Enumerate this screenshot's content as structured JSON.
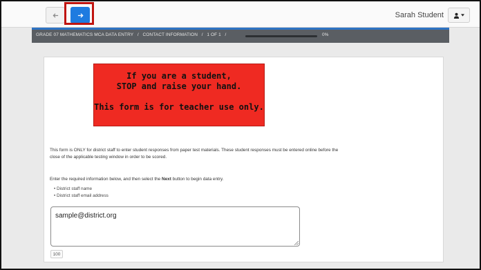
{
  "toolbar": {
    "back_icon": "arrow-left-icon",
    "forward_icon": "arrow-right-icon"
  },
  "user": {
    "name": "Sarah Student",
    "menu_icon": "user-icon"
  },
  "breadcrumb": {
    "items": [
      "GRADE 07 MATHEMATICS MCA DATA ENTRY",
      "CONTACT INFORMATION",
      "1 OF 1"
    ],
    "separator": "/",
    "progress_percent": 0,
    "progress_label": "0%"
  },
  "warning": {
    "line1": "If you are a student,",
    "line2": "STOP and raise your hand.",
    "line3": "This form is for teacher use only."
  },
  "content": {
    "paragraph": "This form is ONLY for district staff to enter student responses from paper test materials. These student responses must be entered online before the close of the applicable testing window in order to be scored.",
    "instruction_before": "Enter the required information below, and then select the ",
    "instruction_bold": "Next",
    "instruction_after": " button to begin data entry.",
    "bullets": [
      "District staff name",
      "District staff email address"
    ]
  },
  "input": {
    "value": "sample@district.org",
    "char_count": "100"
  },
  "colors": {
    "accent_blue": "#1e7be0",
    "highlight_red": "#c0140f",
    "warning_red": "#ef2a22",
    "breadcrumb_bar": "#5a5e63"
  }
}
